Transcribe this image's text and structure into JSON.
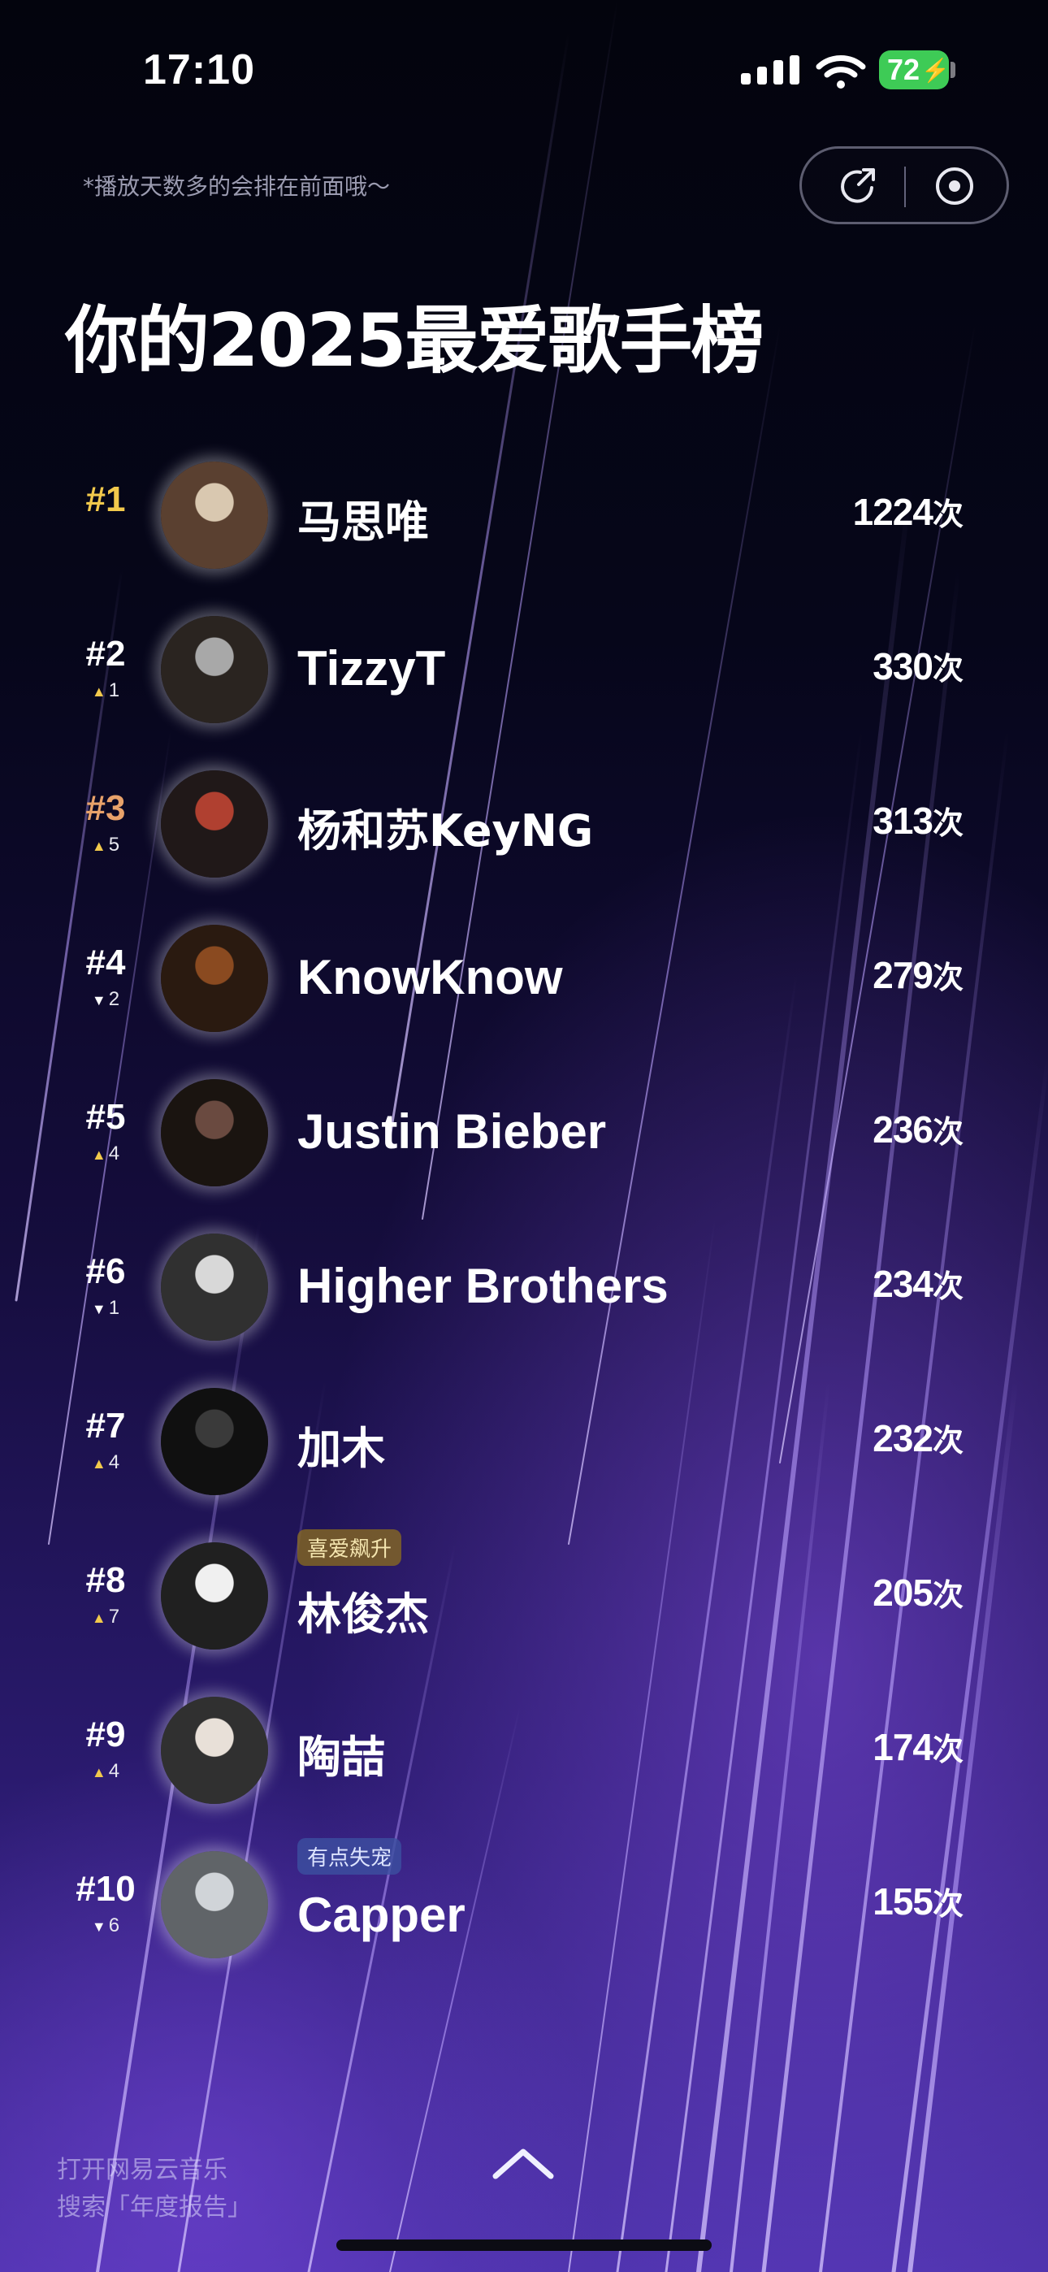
{
  "status_bar": {
    "time": "17:10",
    "battery": "72"
  },
  "hint": "*播放天数多的会排在前面哦～",
  "title": "你的2025最爱歌手榜",
  "rank_colors": {
    "gold": "#f2c94c",
    "bronze": "#e8a26a",
    "default": "#ffffff"
  },
  "artists": [
    {
      "rank": "#1",
      "trend": "",
      "trend_dir": "",
      "name": "马思唯",
      "count": "1224",
      "unit": "次",
      "tag": ""
    },
    {
      "rank": "#2",
      "trend": "1",
      "trend_dir": "up",
      "name": "TizzyT",
      "count": "330",
      "unit": "次",
      "tag": ""
    },
    {
      "rank": "#3",
      "trend": "5",
      "trend_dir": "up",
      "name": "杨和苏KeyNG",
      "count": "313",
      "unit": "次",
      "tag": ""
    },
    {
      "rank": "#4",
      "trend": "2",
      "trend_dir": "down",
      "name": "KnowKnow",
      "count": "279",
      "unit": "次",
      "tag": ""
    },
    {
      "rank": "#5",
      "trend": "4",
      "trend_dir": "up",
      "name": "Justin Bieber",
      "count": "236",
      "unit": "次",
      "tag": ""
    },
    {
      "rank": "#6",
      "trend": "1",
      "trend_dir": "down",
      "name": "Higher Brothers",
      "count": "234",
      "unit": "次",
      "tag": ""
    },
    {
      "rank": "#7",
      "trend": "4",
      "trend_dir": "up",
      "name": "加木",
      "count": "232",
      "unit": "次",
      "tag": ""
    },
    {
      "rank": "#8",
      "trend": "7",
      "trend_dir": "up",
      "name": "林俊杰",
      "count": "205",
      "unit": "次",
      "tag": "喜爱飙升"
    },
    {
      "rank": "#9",
      "trend": "4",
      "trend_dir": "up",
      "name": "陶喆",
      "count": "174",
      "unit": "次",
      "tag": ""
    },
    {
      "rank": "#10",
      "trend": "6",
      "trend_dir": "down",
      "name": "Capper",
      "count": "155",
      "unit": "次",
      "tag": "有点失宠"
    }
  ],
  "footer": {
    "line1": "打开网易云音乐",
    "line2": "搜索「年度报告」"
  },
  "icons": [
    "signal-icon",
    "wifi-icon",
    "battery-icon",
    "share-icon",
    "record-icon",
    "chevron-up-icon"
  ]
}
